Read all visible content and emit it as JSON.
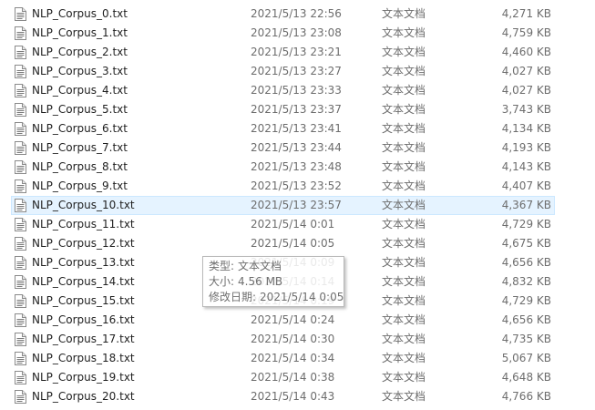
{
  "files": [
    {
      "name": "NLP_Corpus_0.txt",
      "date": "2021/5/13 22:56",
      "type": "文本文档",
      "size": "4,271 KB"
    },
    {
      "name": "NLP_Corpus_1.txt",
      "date": "2021/5/13 23:08",
      "type": "文本文档",
      "size": "4,759 KB"
    },
    {
      "name": "NLP_Corpus_2.txt",
      "date": "2021/5/13 23:21",
      "type": "文本文档",
      "size": "4,460 KB"
    },
    {
      "name": "NLP_Corpus_3.txt",
      "date": "2021/5/13 23:27",
      "type": "文本文档",
      "size": "4,027 KB"
    },
    {
      "name": "NLP_Corpus_4.txt",
      "date": "2021/5/13 23:33",
      "type": "文本文档",
      "size": "4,027 KB"
    },
    {
      "name": "NLP_Corpus_5.txt",
      "date": "2021/5/13 23:37",
      "type": "文本文档",
      "size": "3,743 KB"
    },
    {
      "name": "NLP_Corpus_6.txt",
      "date": "2021/5/13 23:41",
      "type": "文本文档",
      "size": "4,134 KB"
    },
    {
      "name": "NLP_Corpus_7.txt",
      "date": "2021/5/13 23:44",
      "type": "文本文档",
      "size": "4,193 KB"
    },
    {
      "name": "NLP_Corpus_8.txt",
      "date": "2021/5/13 23:48",
      "type": "文本文档",
      "size": "4,143 KB"
    },
    {
      "name": "NLP_Corpus_9.txt",
      "date": "2021/5/13 23:52",
      "type": "文本文档",
      "size": "4,407 KB"
    },
    {
      "name": "NLP_Corpus_10.txt",
      "date": "2021/5/13 23:57",
      "type": "文本文档",
      "size": "4,367 KB"
    },
    {
      "name": "NLP_Corpus_11.txt",
      "date": "2021/5/14 0:01",
      "type": "文本文档",
      "size": "4,729 KB"
    },
    {
      "name": "NLP_Corpus_12.txt",
      "date": "2021/5/14 0:05",
      "type": "文本文档",
      "size": "4,675 KB"
    },
    {
      "name": "NLP_Corpus_13.txt",
      "date": "2021/5/14 0:09",
      "type": "文本文档",
      "size": "4,656 KB"
    },
    {
      "name": "NLP_Corpus_14.txt",
      "date": "2021/5/14 0:14",
      "type": "文本文档",
      "size": "4,832 KB"
    },
    {
      "name": "NLP_Corpus_15.txt",
      "date": "2021/5/14 0:19",
      "type": "文本文档",
      "size": "4,729 KB"
    },
    {
      "name": "NLP_Corpus_16.txt",
      "date": "2021/5/14 0:24",
      "type": "文本文档",
      "size": "4,656 KB"
    },
    {
      "name": "NLP_Corpus_17.txt",
      "date": "2021/5/14 0:30",
      "type": "文本文档",
      "size": "4,735 KB"
    },
    {
      "name": "NLP_Corpus_18.txt",
      "date": "2021/5/14 0:34",
      "type": "文本文档",
      "size": "5,067 KB"
    },
    {
      "name": "NLP_Corpus_19.txt",
      "date": "2021/5/14 0:38",
      "type": "文本文档",
      "size": "4,648 KB"
    },
    {
      "name": "NLP_Corpus_20.txt",
      "date": "2021/5/14 0:43",
      "type": "文本文档",
      "size": "4,766 KB"
    }
  ],
  "hovered_index": 10,
  "tooltip": {
    "type_label": "类型:",
    "type_value": "文本文档",
    "size_label": "大小:",
    "size_value": "4.56 MB",
    "modified_label": "修改日期:",
    "modified_value": "2021/5/14 0:05"
  },
  "colors": {
    "hover_bg": "#e5f3ff",
    "hover_border": "#cce8ff",
    "secondary_text": "#6d6d6d"
  },
  "icons": {
    "file": "text-file-icon"
  }
}
